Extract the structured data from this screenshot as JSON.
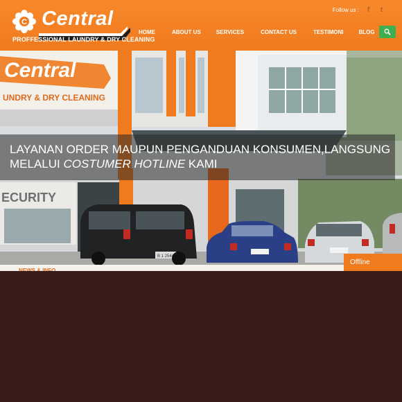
{
  "brand": {
    "name": "Central",
    "tagline": "PROFFESSIONAL LAUNDRY & DRY CLEANING",
    "accent": "#f07a1e"
  },
  "social": {
    "label": "Follow us :",
    "icons": [
      "facebook-icon",
      "twitter-icon"
    ]
  },
  "nav": {
    "items": [
      {
        "label": "HOME"
      },
      {
        "label": "ABOUT US"
      },
      {
        "label": "SERVICES"
      },
      {
        "label": "CONTACT US"
      },
      {
        "label": "TESTIMONI"
      },
      {
        "label": "BLOG"
      }
    ],
    "search_icon": "search-icon"
  },
  "hero": {
    "caption_line1": "LAYANAN ORDER MAUPUN PENGANDUAN KONSUMEN,LANGSUNG",
    "caption_line2_prefix": "MELALUI ",
    "caption_line2_em": "COSTUMER HOTLINE",
    "caption_line2_suffix": " KAMI",
    "photo_sign_name": "Central",
    "photo_sign_tagline": "UNDRY & DRY CLEANING",
    "photo_security": "ECURITY",
    "plate": "B 1 2544"
  },
  "news": {
    "heading": "NEWS & INFO"
  },
  "chat": {
    "status": "Offline"
  }
}
